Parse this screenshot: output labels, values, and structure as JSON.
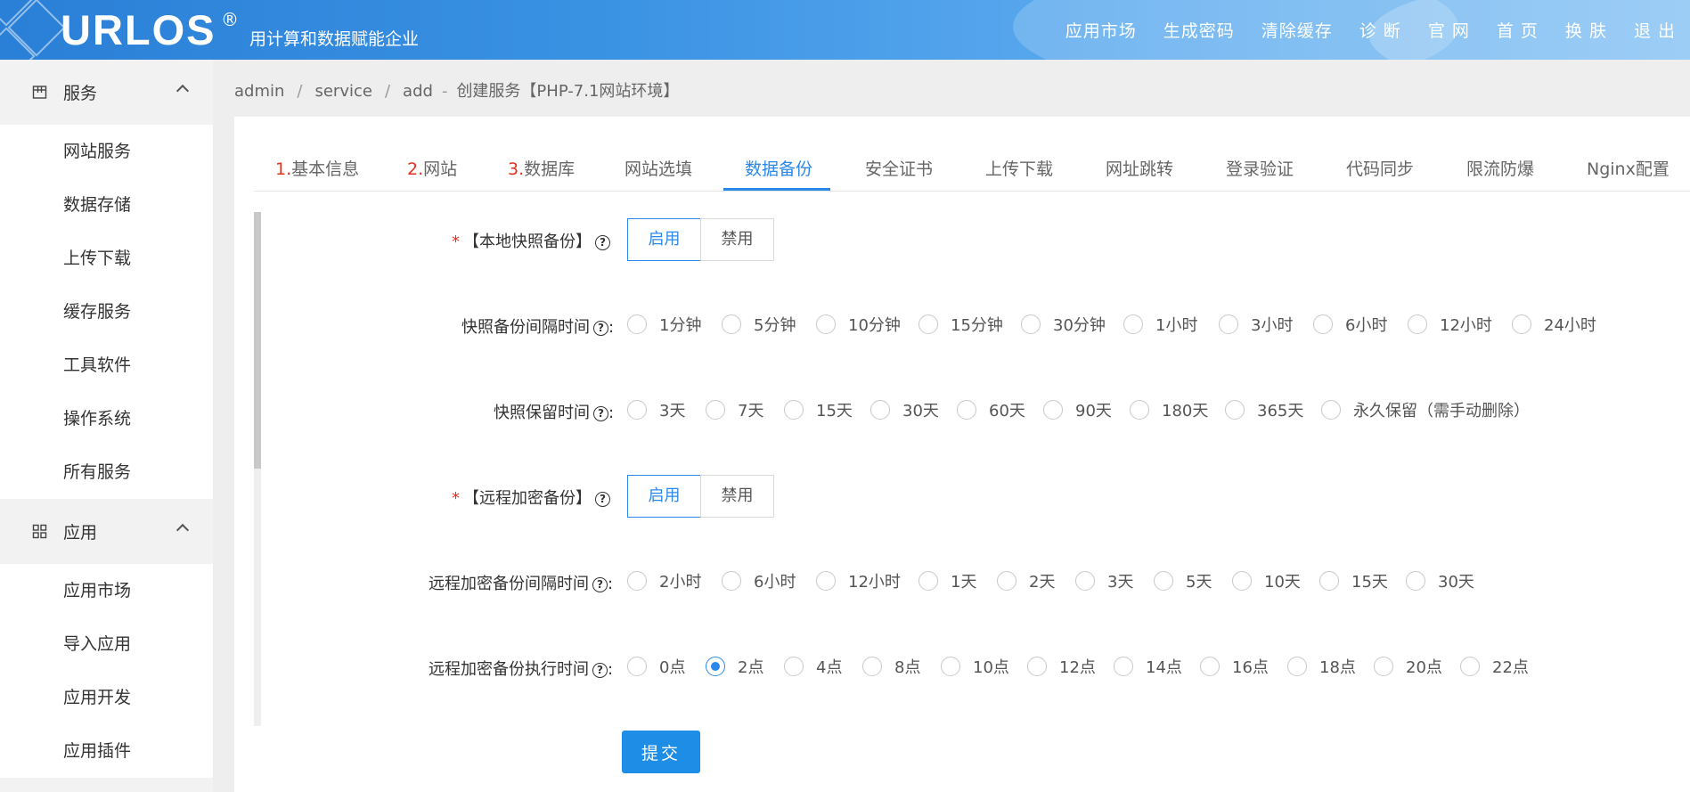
{
  "header": {
    "logo": "URLOS",
    "logo_mark": "®",
    "slogan": "用计算和数据赋能企业",
    "nav": [
      "应用市场",
      "生成密码",
      "清除缓存",
      "诊 断",
      "官 网",
      "首 页",
      "换 肤",
      "退 出"
    ]
  },
  "sidebar": {
    "groups": [
      {
        "label": "服务",
        "icon": "service-icon",
        "items": [
          "网站服务",
          "数据存储",
          "上传下载",
          "缓存服务",
          "工具软件",
          "操作系统",
          "所有服务"
        ]
      },
      {
        "label": "应用",
        "icon": "grid-icon",
        "items": [
          "应用市场",
          "导入应用",
          "应用开发",
          "应用插件"
        ]
      }
    ]
  },
  "breadcrumb": {
    "parts": [
      "admin",
      "service",
      "add"
    ],
    "title": "创建服务【PHP-7.1网站环境】"
  },
  "tabs": [
    {
      "num": "1.",
      "label": "基本信息"
    },
    {
      "num": "2.",
      "label": "网站"
    },
    {
      "num": "3.",
      "label": "数据库"
    },
    {
      "num": "",
      "label": "网站选填"
    },
    {
      "num": "",
      "label": "数据备份"
    },
    {
      "num": "",
      "label": "安全证书"
    },
    {
      "num": "",
      "label": "上传下载"
    },
    {
      "num": "",
      "label": "网址跳转"
    },
    {
      "num": "",
      "label": "登录验证"
    },
    {
      "num": "",
      "label": "代码同步"
    },
    {
      "num": "",
      "label": "限流防爆"
    },
    {
      "num": "",
      "label": "Nginx配置"
    }
  ],
  "active_tab": "数据备份",
  "form": {
    "local_snapshot": {
      "required_mark": "*",
      "label": "【本地快照备份】",
      "options": [
        "启用",
        "禁用"
      ],
      "selected": "启用"
    },
    "snapshot_interval": {
      "label": "快照备份间隔时间",
      "suffix": ":",
      "options": [
        "1分钟",
        "5分钟",
        "10分钟",
        "15分钟",
        "30分钟",
        "1小时",
        "3小时",
        "6小时",
        "12小时",
        "24小时"
      ],
      "selected": null
    },
    "snapshot_retention": {
      "label": "快照保留时间",
      "suffix": ":",
      "options": [
        "3天",
        "7天",
        "15天",
        "30天",
        "60天",
        "90天",
        "180天",
        "365天",
        "永久保留（需手动删除）"
      ],
      "selected": null
    },
    "remote_backup": {
      "required_mark": "*",
      "label": "【远程加密备份】",
      "options": [
        "启用",
        "禁用"
      ],
      "selected": "启用"
    },
    "remote_interval": {
      "label": "远程加密备份间隔时间",
      "suffix": ":",
      "options": [
        "2小时",
        "6小时",
        "12小时",
        "1天",
        "2天",
        "3天",
        "5天",
        "10天",
        "15天",
        "30天"
      ],
      "selected": null
    },
    "remote_exec_time": {
      "label": "远程加密备份执行时间",
      "suffix": ":",
      "options": [
        "0点",
        "2点",
        "4点",
        "8点",
        "10点",
        "12点",
        "14点",
        "16点",
        "18点",
        "20点",
        "22点"
      ],
      "selected": "2点"
    },
    "submit_label": "提交"
  },
  "colors": {
    "accent": "#2b88e8",
    "required": "#e0321f",
    "submit": "#1e8de6"
  }
}
